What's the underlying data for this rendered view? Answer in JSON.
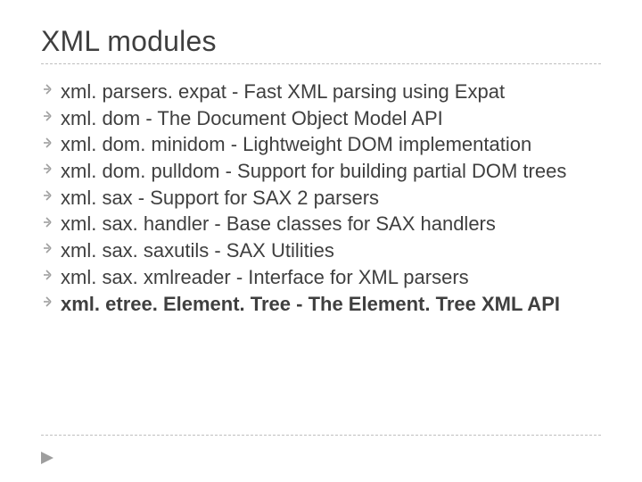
{
  "title": "XML modules",
  "items": [
    {
      "text": "xml. parsers. expat - Fast XML parsing using Expat",
      "bold": false
    },
    {
      "text": "xml. dom - The Document Object Model API",
      "bold": false
    },
    {
      "text": "xml. dom. minidom - Lightweight DOM implementation",
      "bold": false
    },
    {
      "text": "xml. dom. pulldom  - Support for building partial DOM trees",
      "bold": false
    },
    {
      "text": "xml. sax - Support for SAX 2 parsers",
      "bold": false
    },
    {
      "text": "xml. sax. handler - Base classes for SAX handlers",
      "bold": false
    },
    {
      "text": "xml. sax. saxutils - SAX Utilities",
      "bold": false
    },
    {
      "text": "xml. sax. xmlreader - Interface for XML parsers",
      "bold": false
    },
    {
      "text": "xml. etree. Element. Tree - The Element. Tree XML API",
      "bold": true
    }
  ]
}
